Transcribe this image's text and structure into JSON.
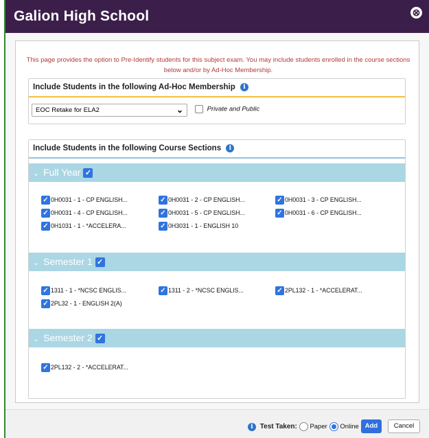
{
  "dialog": {
    "title": "Galion High School",
    "close_icon": "⊗",
    "intro_text": "This page provides the option to Pre-Identify students for this subject exam. You may include students enrolled in the course sections below and/or by Ad-Hoc Membership."
  },
  "adhoc": {
    "header": "Include Students in the following Ad-Hoc Membership",
    "selected": "EOC Retake for ELA2",
    "private_public_label": "Private and Public",
    "private_public_checked": false
  },
  "sections": {
    "header": "Include Students in the following Course Sections",
    "groups": [
      {
        "label": "Full Year",
        "checked": true,
        "items": [
          "0H0031 - 1 - CP ENGLISH...",
          "0H0031 - 2 - CP ENGLISH...",
          "0H0031 - 3 - CP ENGLISH...",
          "0H0031 - 4 - CP ENGLISH...",
          "0H0031 - 5 - CP ENGLISH...",
          "0H0031 - 6 - CP ENGLISH...",
          "0H1031 - 1 - *ACCELERA...",
          "0H3031 - 1 - ENGLISH 10"
        ]
      },
      {
        "label": "Semester 1",
        "checked": true,
        "items": [
          "1311 - 1 - *NCSC ENGLIS...",
          "1311 - 2 - *NCSC ENGLIS...",
          "2PL132 - 1 - *ACCELERAT...",
          "2PL32 - 1 - ENGLISH 2(A)"
        ]
      },
      {
        "label": "Semester 2",
        "checked": true,
        "items": [
          "2PL132 - 2 - *ACCELERAT..."
        ]
      }
    ]
  },
  "footer": {
    "test_taken_label": "Test Taken:",
    "paper_label": "Paper",
    "online_label": "Online",
    "selected_mode": "Online",
    "add_label": "Add",
    "cancel_label": "Cancel"
  },
  "colors": {
    "titlebar": "#3b1f4a",
    "group_bar": "#abd6e4",
    "checkbox": "#2f74e0",
    "intro_text": "#b03a3a",
    "accent_line": "#f0c040"
  }
}
